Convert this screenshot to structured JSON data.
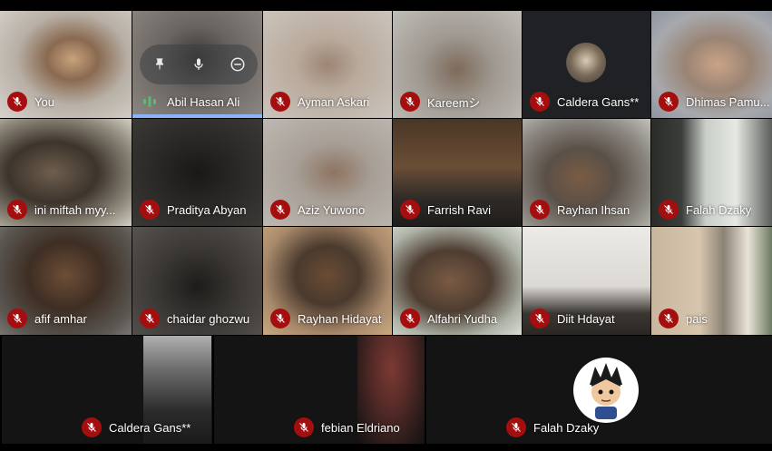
{
  "participants_row1": [
    {
      "name": "You",
      "muted": true
    },
    {
      "name": "Abil Hasan Ali",
      "muted": false,
      "speaking": true
    },
    {
      "name": "Ayman Askari",
      "muted": true
    },
    {
      "name": "Kareemシ",
      "muted": true
    },
    {
      "name": "Caldera Gans**",
      "muted": true
    },
    {
      "name": "Dhimas Pamu...",
      "muted": true
    }
  ],
  "participants_row2": [
    {
      "name": "ini miftah myy...",
      "muted": true
    },
    {
      "name": "Praditya Abyan",
      "muted": true
    },
    {
      "name": "Aziz Yuwono",
      "muted": true
    },
    {
      "name": "Farrish Ravi",
      "muted": true
    },
    {
      "name": "Rayhan Ihsan",
      "muted": true
    },
    {
      "name": "Falah Dzaky",
      "muted": true
    }
  ],
  "participants_row3": [
    {
      "name": "afif amhar",
      "muted": true
    },
    {
      "name": "chaidar ghozwu",
      "muted": true
    },
    {
      "name": "Rayhan Hidayat",
      "muted": true
    },
    {
      "name": "Alfahri Yudha",
      "muted": true
    },
    {
      "name": "Diit Hdayat",
      "muted": true
    },
    {
      "name": "pais",
      "muted": true
    }
  ],
  "participants_row4": [
    {
      "name": "Caldera Gans**",
      "muted": true
    },
    {
      "name": "febian Eldriano",
      "muted": true
    },
    {
      "name": "Falah Dzaky",
      "muted": true
    }
  ],
  "colors": {
    "muted_badge": "#a50e0e",
    "active_speaker": "#8ab4f8",
    "speaking_icon": "#5bb974"
  }
}
